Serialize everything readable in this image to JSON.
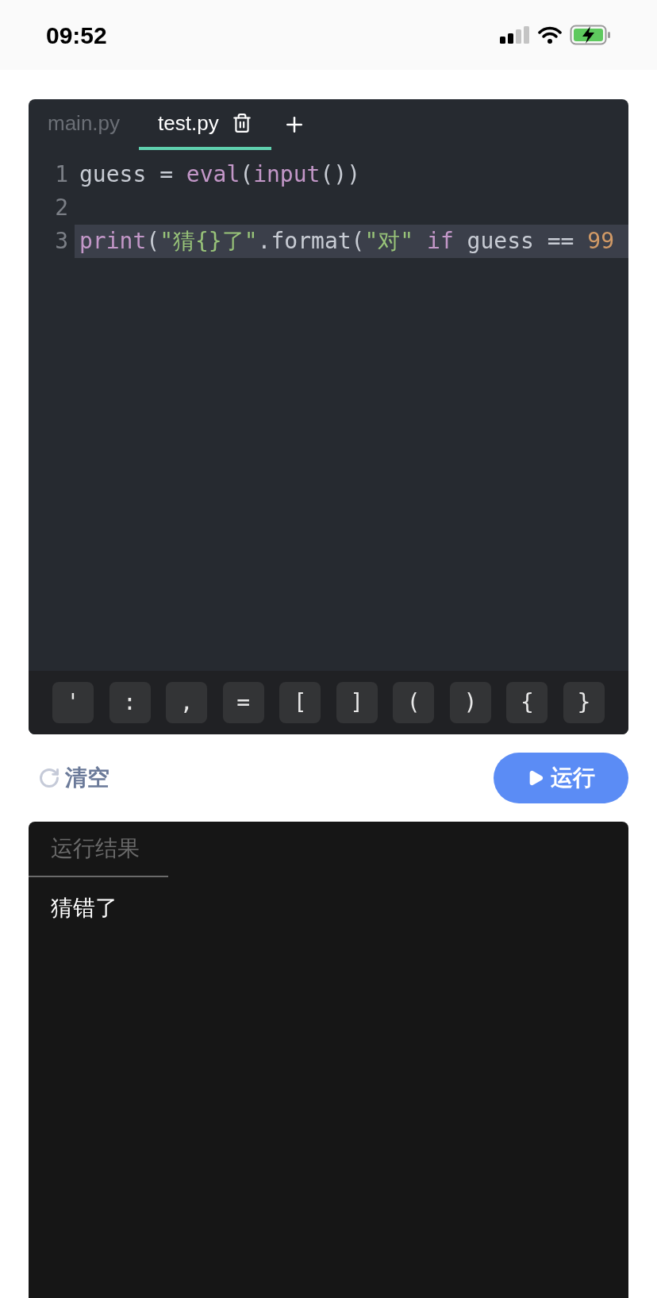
{
  "status_bar": {
    "time": "09:52"
  },
  "editor": {
    "tabs": [
      {
        "label": "main.py",
        "selected": false
      },
      {
        "label": "test.py",
        "selected": true
      }
    ],
    "lines": [
      {
        "number": "1",
        "selected": false,
        "tokens": [
          {
            "kind": "plain",
            "text": "guess = "
          },
          {
            "kind": "builtin",
            "text": "eval"
          },
          {
            "kind": "plain",
            "text": "("
          },
          {
            "kind": "builtin",
            "text": "input"
          },
          {
            "kind": "plain",
            "text": "())"
          }
        ]
      },
      {
        "number": "2",
        "selected": false
      },
      {
        "number": "3",
        "selected": true,
        "tokens": [
          {
            "kind": "builtin",
            "text": "print"
          },
          {
            "kind": "plain",
            "text": "("
          },
          {
            "kind": "string",
            "text": "\"猜{}了\""
          },
          {
            "kind": "plain",
            "text": ".format("
          },
          {
            "kind": "string",
            "text": "\"对\""
          },
          {
            "kind": "builtin",
            "text": " if"
          },
          {
            "kind": "plain",
            "text": " guess == "
          },
          {
            "kind": "number",
            "text": "99"
          }
        ]
      }
    ],
    "keys": [
      "'",
      ":",
      ",",
      "=",
      "[",
      "]",
      "(",
      ")",
      "{",
      "}"
    ]
  },
  "actions": {
    "clear": "清空",
    "run": "运行"
  },
  "output": {
    "tabs": [
      {
        "label": "运行结果",
        "selected": true
      }
    ],
    "text": "猜错了"
  }
}
